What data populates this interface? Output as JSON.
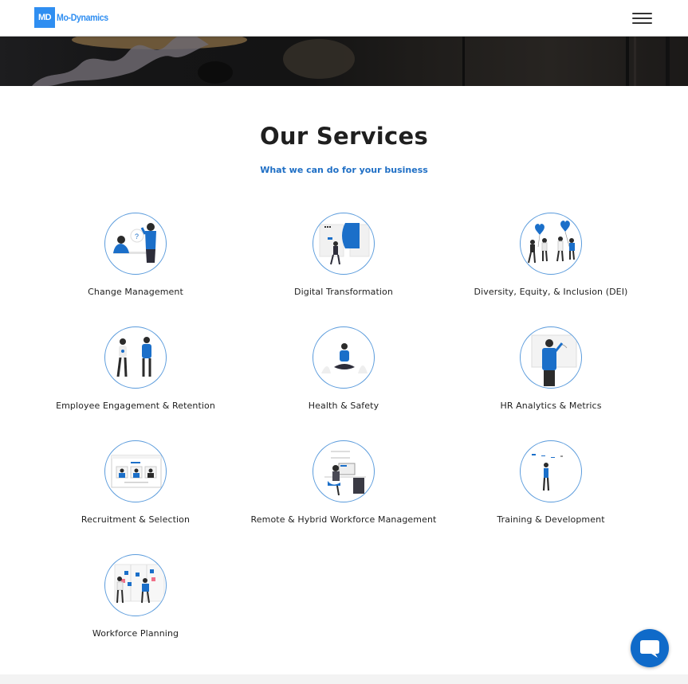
{
  "header": {
    "logo_badge": "MD",
    "logo_text": "Mo-Dynamics",
    "menu_icon": "hamburger-menu-icon"
  },
  "section": {
    "title": "Our Services",
    "subtitle": "What we can do for your business"
  },
  "colors": {
    "brand": "#2f8ef1",
    "accent": "#1f6fc5",
    "illustration_blue": "#1b6fc9",
    "chat_button": "#0f6ac9"
  },
  "services": [
    {
      "label": "Change Management",
      "icon": "two-people-discussion-illustration"
    },
    {
      "label": "Digital Transformation",
      "icon": "person-with-digital-screens-illustration"
    },
    {
      "label": "Diversity, Equity, & Inclusion (DEI)",
      "icon": "people-with-heart-balloons-illustration"
    },
    {
      "label": "Employee Engagement & Retention",
      "icon": "two-colleagues-talking-illustration"
    },
    {
      "label": "Health & Safety",
      "icon": "meditating-person-illustration"
    },
    {
      "label": "HR Analytics & Metrics",
      "icon": "person-at-whiteboard-illustration"
    },
    {
      "label": "Recruitment & Selection",
      "icon": "video-interview-candidates-illustration"
    },
    {
      "label": "Remote & Hybrid Workforce Management",
      "icon": "person-at-desk-computer-illustration"
    },
    {
      "label": "Training & Development",
      "icon": "person-viewing-chart-illustration"
    },
    {
      "label": "Workforce Planning",
      "icon": "people-at-kanban-board-illustration"
    }
  ],
  "chat": {
    "icon": "chat-bubble-icon"
  }
}
